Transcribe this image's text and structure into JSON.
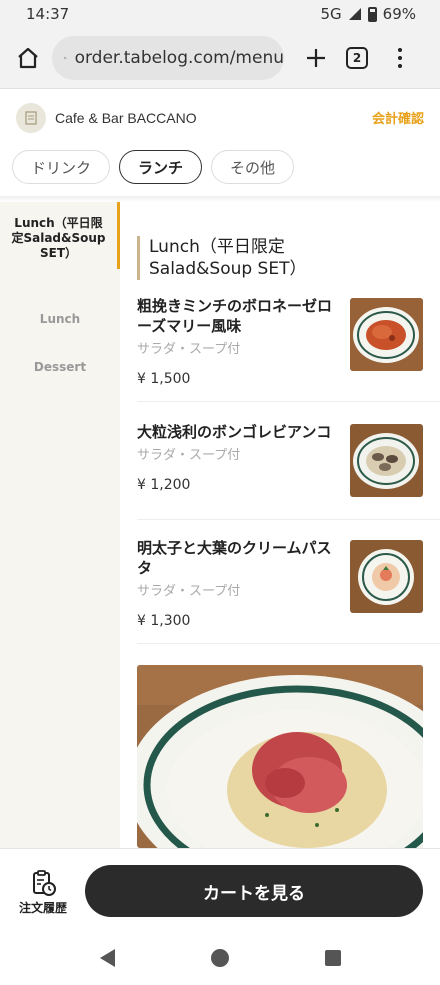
{
  "status_bar": {
    "time": "14:37",
    "network": "5G",
    "battery": "69%"
  },
  "browser": {
    "url": "order.tabelog.com/menu",
    "tab_count": "2"
  },
  "shop": {
    "name": "Cafe & Bar BACCANO",
    "checkout_label": "会計確認",
    "accent_color": "#e8a11b"
  },
  "categories": [
    {
      "label": "ドリンク",
      "active": false
    },
    {
      "label": "ランチ",
      "active": true
    },
    {
      "label": "その他",
      "active": false
    }
  ],
  "sidebar": {
    "items": [
      {
        "label": "Lunch（平日限定Salad&Soup SET）",
        "active": true
      },
      {
        "label": "Lunch",
        "active": false
      },
      {
        "label": "Dessert",
        "active": false
      }
    ]
  },
  "section": {
    "title": "Lunch（平日限定Salad&Soup SET）"
  },
  "menu_items": [
    {
      "name": "粗挽きミンチのボロネーゼローズマリー風味",
      "note": "サラダ・スープ付",
      "price": "¥ 1,500",
      "thumb_icon": "pasta-bolognese-photo"
    },
    {
      "name": "大粒浅利のボンゴレビアンコ",
      "note": "サラダ・スープ付",
      "price": "¥ 1,200",
      "thumb_icon": "pasta-vongole-photo"
    },
    {
      "name": "明太子と大葉のクリームパスタ",
      "note": "サラダ・スープ付",
      "price": "¥ 1,300",
      "thumb_icon": "pasta-mentaiko-photo"
    }
  ],
  "featured_photo": {
    "icon": "prosciutto-pasta-photo"
  },
  "bottom": {
    "history_label": "注文履歴",
    "cart_label": "カートを見る"
  }
}
